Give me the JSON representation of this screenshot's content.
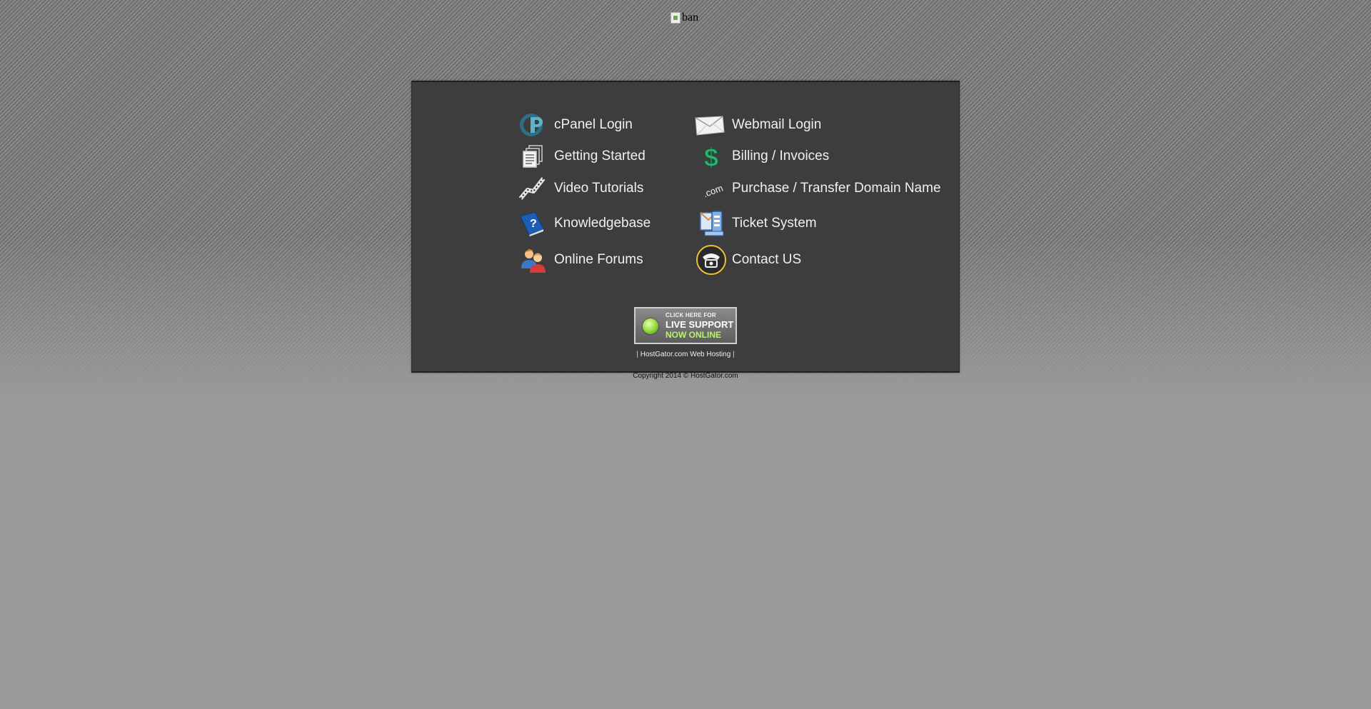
{
  "banner": {
    "alt": "ban"
  },
  "links": {
    "cpanel": "cPanel Login",
    "webmail": "Webmail Login",
    "getting_started": "Getting Started",
    "billing": "Billing / Invoices",
    "video": "Video Tutorials",
    "domain": "Purchase / Transfer Domain Name",
    "kb": "Knowledgebase",
    "ticket": "Ticket System",
    "forums": "Online Forums",
    "contact": "Contact US"
  },
  "icons": {
    "cpanel": "cpanel-logo-icon",
    "webmail": "envelope-icon",
    "getting_started": "documents-icon",
    "billing": "dollar-icon",
    "video": "film-strip-icon",
    "domain": "dot-com-icon",
    "kb": "help-book-icon",
    "ticket": "ticket-mail-icon",
    "forums": "users-icon",
    "contact": "telephone-icon"
  },
  "dotcom_label": ".com",
  "live_support": {
    "line1": "CLICK HERE FOR",
    "line2": "LIVE SUPPORT",
    "line3": "NOW ONLINE",
    "color": "#8fd63a"
  },
  "footer": {
    "sep_left": "| ",
    "link": "HostGator.com Web Hosting",
    "sep_right": " |",
    "copyright": "Copyright 2014 © HostGator.com"
  }
}
